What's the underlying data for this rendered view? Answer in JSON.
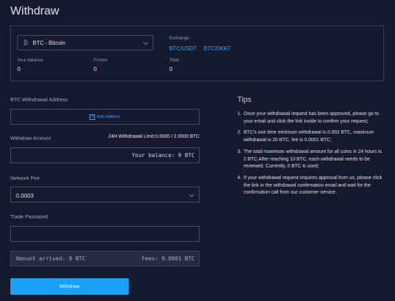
{
  "page": {
    "title": "Withdraw"
  },
  "coin_selector": {
    "value": "BTC - Bitcoin",
    "icon": "bitcoin-icon"
  },
  "exchange": {
    "label": "Exchange",
    "pairs": [
      "BTC/USDT",
      "BTC/DKKT"
    ]
  },
  "balances": [
    {
      "label": "Your balance",
      "value": "0"
    },
    {
      "label": "Frozen",
      "value": "0"
    },
    {
      "label": "Total",
      "value": "0"
    }
  ],
  "form": {
    "address": {
      "label": "BTC Withdrawal Address",
      "add_label": "Add Address"
    },
    "amount": {
      "label": "Withdraw Amount",
      "limit": "24H Withdrawal Limit:0.0000 / 2.0000 BTC",
      "balance_hint": "Your balance: 0 BTC"
    },
    "network_fee": {
      "label": "Network Fee",
      "value": "0.0003"
    },
    "trade_password": {
      "label": "Trade Password",
      "value": ""
    },
    "summary": {
      "arrived": "Amount arrived: 0 BTC",
      "fees": "Fees: 0.0001 BTC"
    },
    "submit_label": "Withdraw"
  },
  "tips": {
    "title": "Tips",
    "items": [
      {
        "num": "1.",
        "text": "Once your withdrawal request has been approved, please go to your email and click the link inside to confirm your request;"
      },
      {
        "num": "2.",
        "text": "BTC's one time minimum withdrawal is 0.002 BTC, maximum withdrawal is 20 BTC, fee is 0.0001 BTC;"
      },
      {
        "num": "3.",
        "text": "The total maximum withdrawal amount for all coins in 24 hours is 2 BTC.After reaching 10 BTC, each withdrawal needs to be reviewed. Currently, 0 BTC is used;"
      },
      {
        "num": "4.",
        "text": "If your withdrawal request requires approval from us, please click the link in the withdrawal confirmation email and wait for the confirmation call from our customer service."
      }
    ]
  },
  "colors": {
    "background": "#151a2e",
    "accent": "#19a2f5",
    "link": "#3ba6f5",
    "border": "#4a526a"
  }
}
